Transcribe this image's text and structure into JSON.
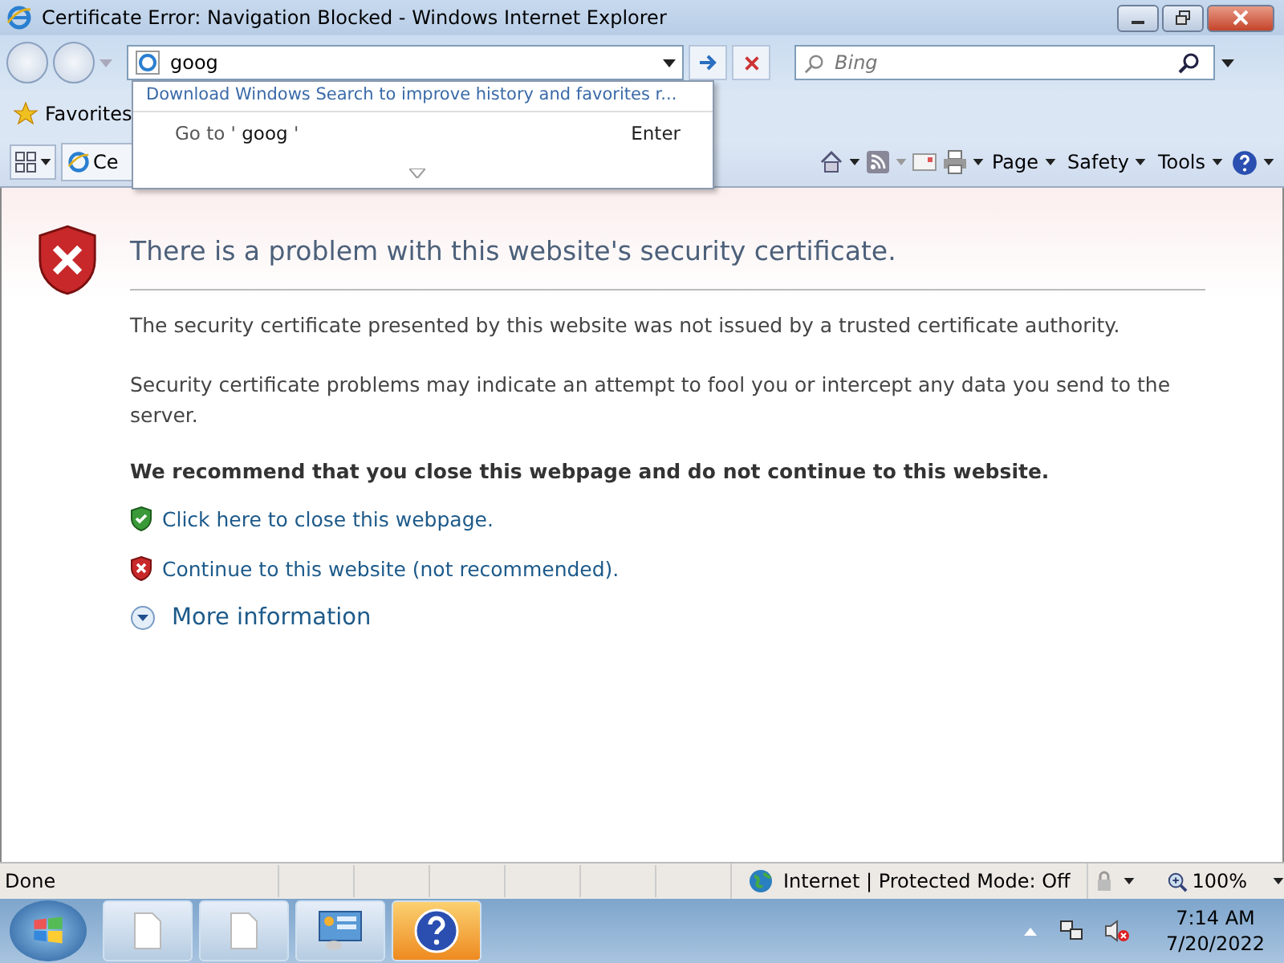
{
  "window": {
    "title": "Certificate Error: Navigation Blocked - Windows Internet Explorer"
  },
  "address_bar": {
    "value": "goog"
  },
  "search": {
    "placeholder": "Bing"
  },
  "autocomplete": {
    "banner": "Download Windows Search to improve history and favorites r...",
    "goto_label": "Go to '",
    "goto_query": "goog",
    "goto_end": "'",
    "shortcut": "Enter"
  },
  "favorites_bar": {
    "label": "Favorites"
  },
  "tab": {
    "label": "Ce"
  },
  "command_bar": [
    {
      "label": "Page"
    },
    {
      "label": "Safety"
    },
    {
      "label": "Tools"
    }
  ],
  "page": {
    "heading": "There is a problem with this website's security certificate.",
    "paragraphs": [
      "The security certificate presented by this website was not issued by a trusted certificate authority.",
      "Security certificate problems may indicate an attempt to fool you or intercept any data you send to the server."
    ],
    "recommendation": "We recommend that you close this webpage and do not continue to this website.",
    "links": [
      {
        "kind": "safe",
        "label": "Click here to close this webpage."
      },
      {
        "kind": "unsafe",
        "label": "Continue to this website (not recommended)."
      }
    ],
    "more": {
      "label": "More information",
      "expanded": false
    }
  },
  "status_bar": {
    "text": "Done",
    "zone": "Internet | Protected Mode: Off",
    "zoom": "100%"
  },
  "taskbar": {
    "time": "7:14 AM",
    "date": "7/20/2022"
  }
}
